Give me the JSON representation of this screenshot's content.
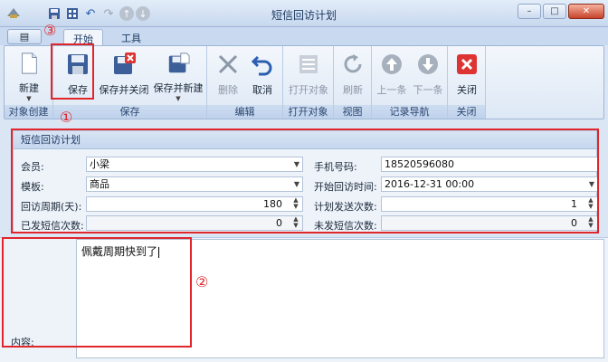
{
  "window": {
    "title": "短信回访计划",
    "controls": {
      "minimize": "–",
      "maximize": "□",
      "close": "✕"
    }
  },
  "quick_access": {
    "undo": "↶",
    "redo": "↷",
    "up": "↑",
    "down": "↓"
  },
  "tabs": {
    "app_menu": "▤",
    "start": "开始",
    "tools": "工具"
  },
  "ribbon": {
    "groups": [
      {
        "label": "对象创建"
      },
      {
        "label": "保存"
      },
      {
        "label": "编辑"
      },
      {
        "label": "打开对象"
      },
      {
        "label": "视图"
      },
      {
        "label": "记录导航"
      },
      {
        "label": "关闭"
      }
    ],
    "buttons": {
      "new": "新建",
      "save": "保存",
      "save_close": "保存并关闭",
      "save_new": "保存并新建",
      "delete": "删除",
      "cancel": "取消",
      "open_object": "打开对象",
      "refresh": "刷新",
      "prev": "上一条",
      "next": "下一条",
      "close": "关闭"
    }
  },
  "form": {
    "panel_title": "短信回访计划",
    "member_label": "会员:",
    "member_value": "小梁",
    "phone_label": "手机号码:",
    "phone_value": "18520596080",
    "template_label": "模板:",
    "template_value": "商品",
    "start_time_label": "开始回访时间:",
    "start_time_value": "2016-12-31 00:00",
    "period_label": "回访周期(天):",
    "period_value": "180",
    "plan_count_label": "计划发送次数:",
    "plan_count_value": "1",
    "sent_count_label": "已发短信次数:",
    "sent_count_value": "0",
    "unsent_count_label": "未发短信次数:",
    "unsent_count_value": "0",
    "content_label": "内容:",
    "content_value": "佩戴周期快到了"
  },
  "annotations": {
    "one": "①",
    "two": "②",
    "three": "③"
  },
  "colors": {
    "annotation": "#e0262b",
    "accent": "#1c3a63"
  }
}
